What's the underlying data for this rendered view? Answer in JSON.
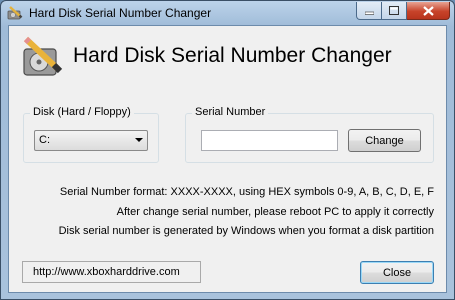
{
  "window": {
    "title": "Hard Disk Serial Number Changer",
    "accent": "#c7432a"
  },
  "header": {
    "app_title": "Hard Disk Serial Number Changer",
    "logo_icon": "hdd-pencil-icon"
  },
  "disk_group": {
    "label": "Disk (Hard / Floppy)",
    "selected": "C:"
  },
  "serial_group": {
    "label": "Serial Number",
    "input_value": "",
    "change_label": "Change"
  },
  "info": {
    "format_line": "Serial Number format: XXXX-XXXX, using HEX symbols 0-9, A, B, C, D, E, F",
    "reboot_line": "After change serial number, please reboot PC to apply it correctly",
    "generated_line": "Disk serial number is generated by Windows when you format a disk partition"
  },
  "footer": {
    "url": "http://www.xboxharddrive.com",
    "close_label": "Close"
  }
}
